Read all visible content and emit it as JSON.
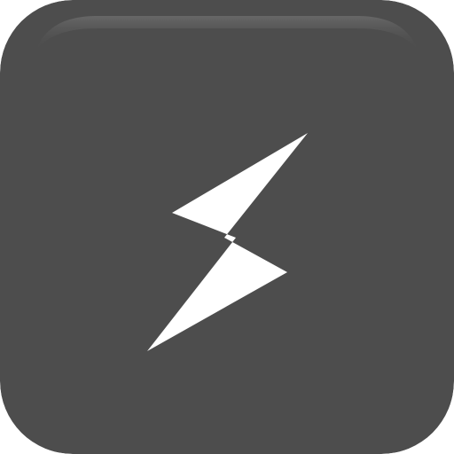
{
  "icon": {
    "name": "lightning-bolt",
    "background_color": "#4d4d4d",
    "highlight_color": "#5e5e5e",
    "bolt_color": "#ffffff"
  }
}
